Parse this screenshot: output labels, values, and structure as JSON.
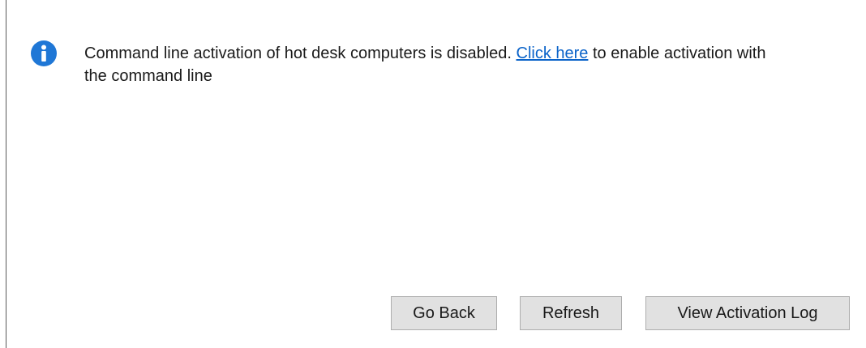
{
  "message": {
    "text_before": "Command line activation of hot desk computers is disabled.",
    "link_text": "Click here",
    "text_after": "to enable activation with the command line",
    "icon": "info-icon"
  },
  "buttons": {
    "go_back": "Go Back",
    "refresh": "Refresh",
    "view_log": "View Activation Log"
  },
  "colors": {
    "accent": "#1f77d6",
    "link": "#0a63c9",
    "button_bg": "#e1e1e1",
    "button_border": "#adadad"
  }
}
